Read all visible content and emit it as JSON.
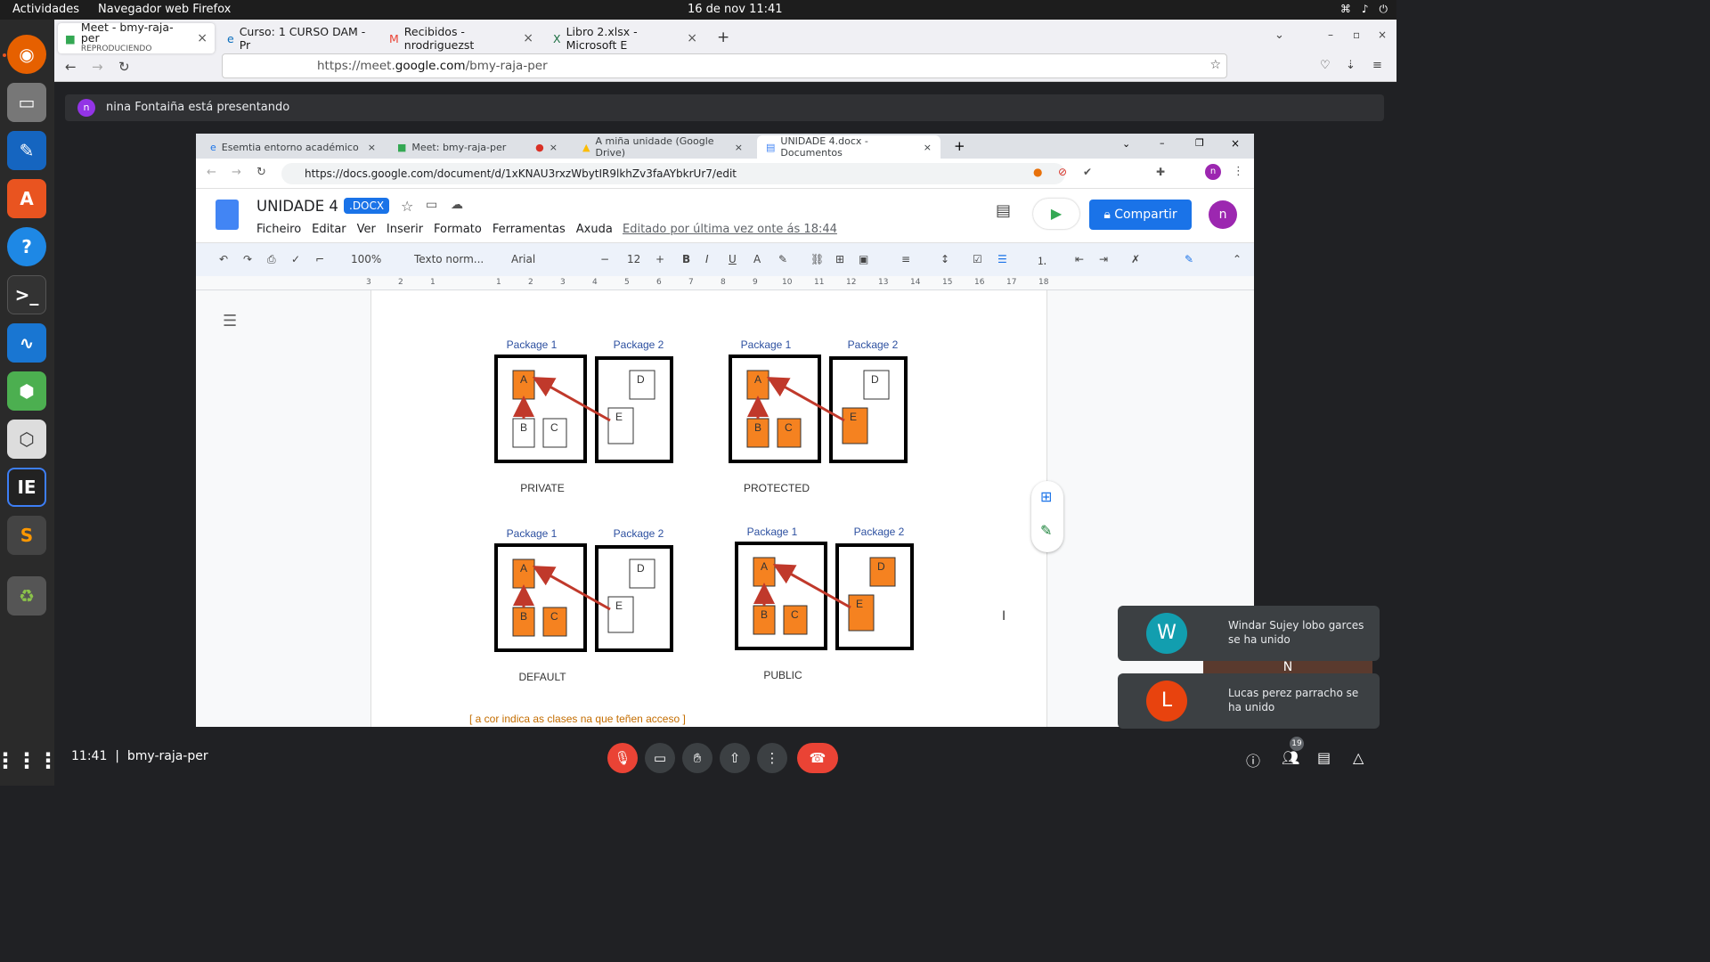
{
  "system": {
    "activities": "Actividades",
    "app_name": "Navegador web Firefox",
    "clock": "16 de nov  11:41"
  },
  "firefox": {
    "tabs": [
      {
        "title": "Meet - bmy-raja-per",
        "subtitle": "REPRODUCIENDO"
      },
      {
        "title": "Curso: 1 CURSO DAM - Pr"
      },
      {
        "title": "Recibidos - nrodriguezst"
      },
      {
        "title": "Libro 2.xlsx - Microsoft E"
      }
    ],
    "url_prefix": "https://meet.",
    "url_domain": "google.com",
    "url_path": "/bmy-raja-per"
  },
  "meet": {
    "presenter_initial": "n",
    "presenting_text": "nina Fontaiña está presentando",
    "time": "11:41",
    "separator": "|",
    "meeting_code": "bmy-raja-per",
    "participant_count": "19",
    "notifications": [
      {
        "initial": "W",
        "text": "Windar Sujey lobo garces se ha unido",
        "color": "#129eaf"
      },
      {
        "initial": "L",
        "text": "Lucas perez parracho se ha unido",
        "color": "#e8430e"
      }
    ],
    "hidden_tile_initial": "N"
  },
  "chrome": {
    "tabs": [
      {
        "title": "Esemtia entorno académico"
      },
      {
        "title": "Meet: bmy-raja-per"
      },
      {
        "title": "A miña unidade (Google Drive)"
      },
      {
        "title": "UNIDADE 4.docx - Documentos"
      }
    ],
    "url": "https://docs.google.com/document/d/1xKNAU3rxzWbytIR9lkhZv3faAYbkrUr7/edit"
  },
  "docs": {
    "title": "UNIDADE 4",
    "badge": ".DOCX",
    "menu": [
      "Ficheiro",
      "Editar",
      "Ver",
      "Inserir",
      "Formato",
      "Ferramentas",
      "Axuda"
    ],
    "edited": "Editado por última vez onte ás 18:44",
    "share": "Compartir",
    "user_initial": "n",
    "zoom": "100%",
    "style": "Texto norm...",
    "font": "Arial",
    "font_size": "12",
    "ruler": [
      "3",
      "2",
      "1",
      "1",
      "2",
      "3",
      "4",
      "5",
      "6",
      "7",
      "8",
      "9",
      "10",
      "11",
      "12",
      "13",
      "14",
      "15",
      "16",
      "17",
      "18"
    ]
  },
  "diagram": {
    "package1": "Package 1",
    "package2": "Package 2",
    "captions": [
      "PRIVATE",
      "PROTECTED",
      "DEFAULT",
      "PUBLIC"
    ],
    "classes": [
      "A",
      "B",
      "C",
      "D",
      "E"
    ],
    "highlight_color": "#f58220",
    "bottom_note": "[ a cor indica as clases na que teñen acceso ]"
  }
}
